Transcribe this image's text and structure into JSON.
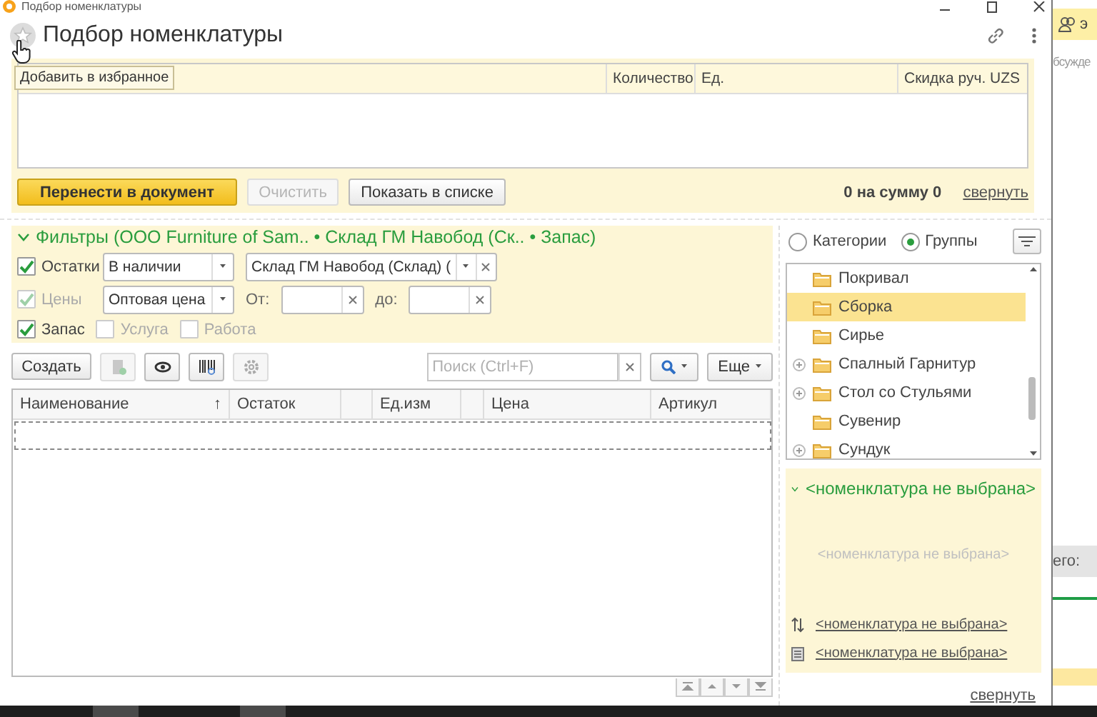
{
  "window": {
    "title": "Подбор номенклатуры"
  },
  "header": {
    "title": "Подбор номенклатуры",
    "tooltip": "Добавить в избранное"
  },
  "selected_table": {
    "columns": [
      {
        "label": "Количество"
      },
      {
        "label": "Ед."
      },
      {
        "label": "Скидка руч. UZS"
      }
    ]
  },
  "buttons": [
    {
      "label": "Перенести в документ",
      "kind": "primary",
      "disabled": false
    },
    {
      "label": "Очистить",
      "kind": "normal",
      "disabled": true
    },
    {
      "label": "Показать в списке",
      "kind": "normal",
      "disabled": false
    }
  ],
  "total": "0 на сумму 0",
  "collapse_link": "свернуть",
  "filters": {
    "expanded": true,
    "title": "Фильтры (ООО Furniture of Sam.. • Склад ГМ Навобод (Ск.. • Запас)",
    "stock": {
      "label": "Остатки",
      "checked": true,
      "disabled": false,
      "mode": "В наличии",
      "warehouse": "Склад ГМ Навобод (Склад) ("
    },
    "prices": {
      "label": "Цены",
      "checked": true,
      "disabled": true,
      "price_type": "Оптовая цена",
      "from_label": "От:",
      "to_label": "до:"
    },
    "types": [
      {
        "label": "Запас",
        "checked": true,
        "disabled": false
      },
      {
        "label": "Услуга",
        "checked": false,
        "disabled": true
      },
      {
        "label": "Работа",
        "checked": false,
        "disabled": true
      }
    ]
  },
  "toolbar": {
    "create": "Создать",
    "search_placeholder": "Поиск (Ctrl+F)",
    "more": "Еще"
  },
  "list_table": {
    "columns": [
      {
        "label": "Наименование",
        "sort_mark": "↑"
      },
      {
        "label": "Остаток"
      },
      {
        "label": "Ед.изм"
      },
      {
        "label": "Цена"
      },
      {
        "label": "Артикул"
      }
    ]
  },
  "view_mode": [
    {
      "label": "Категории",
      "selected": false
    },
    {
      "label": "Группы",
      "selected": true
    }
  ],
  "groups": [
    {
      "label": "Покривал",
      "expandable": false,
      "selected": false
    },
    {
      "label": "Сборка",
      "expandable": false,
      "selected": true
    },
    {
      "label": "Сирье",
      "expandable": false,
      "selected": false
    },
    {
      "label": "Спалный Гарнитур",
      "expandable": true,
      "selected": false
    },
    {
      "label": "Стол со Стульями",
      "expandable": true,
      "selected": false
    },
    {
      "label": "Сувенир",
      "expandable": false,
      "selected": false
    },
    {
      "label": "Сундук",
      "expandable": true,
      "selected": false
    }
  ],
  "details": {
    "expanded": true,
    "title": "<номенклатура не выбрана>",
    "empty_text": "<номенклатура не выбрана>",
    "links": [
      {
        "kind": "analogs",
        "text": "<номенклатура не выбрана>"
      },
      {
        "kind": "document",
        "text": "<номенклатура не выбрана>"
      }
    ],
    "collapse_link": "свернуть"
  },
  "background_app": {
    "tab_label": "э",
    "discussion_label": "бсужде",
    "total_label": "его:"
  }
}
